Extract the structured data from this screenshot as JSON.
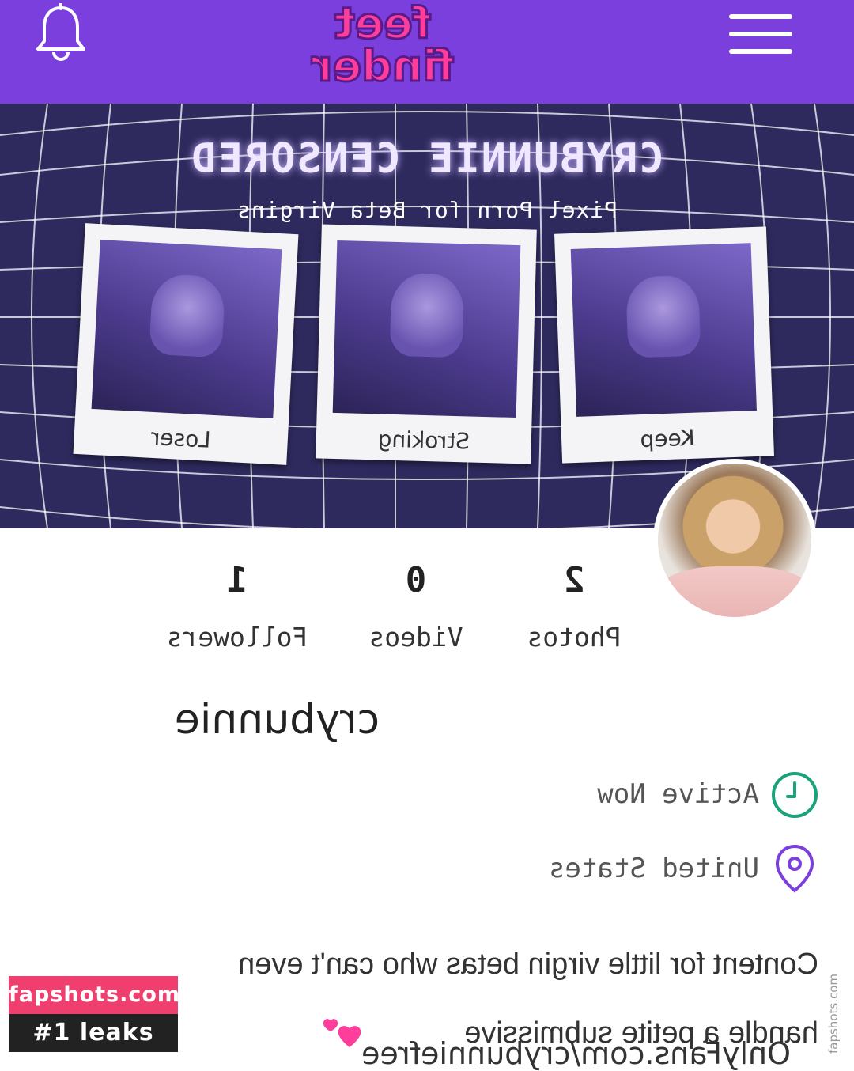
{
  "header": {
    "logo_text_line1": "feet",
    "logo_text_line2": "finder",
    "bell_icon": "bell-icon",
    "menu_icon": "hamburger-menu-icon",
    "bg_color": "#7a3fdc"
  },
  "banner": {
    "title": "CRYBUNNIE CENSORED",
    "subtitle": "Pixel Porn for Beta Virgins",
    "polaroids": [
      {
        "caption": "Keep"
      },
      {
        "caption": "Stroking"
      },
      {
        "caption": "Loser"
      }
    ]
  },
  "stats": [
    {
      "value": "2",
      "label": "Photos"
    },
    {
      "value": "0",
      "label": "Videos"
    },
    {
      "value": "1",
      "label": "Followers"
    }
  ],
  "profile": {
    "username": "crybunnie",
    "status": "Active Now",
    "location": "United States",
    "status_icon_color": "#1aa37a",
    "location_icon_color": "#7a3fdc",
    "bio_line1": "Content for little virgin betas who can't even",
    "bio_line2": "handle a petite submissive",
    "bio_line3": "OnlyFans.com/crybunniefree"
  },
  "watermark": {
    "line1": "fapshots.com",
    "line2": "#1 leaks",
    "side_text": "fapshots.com"
  }
}
